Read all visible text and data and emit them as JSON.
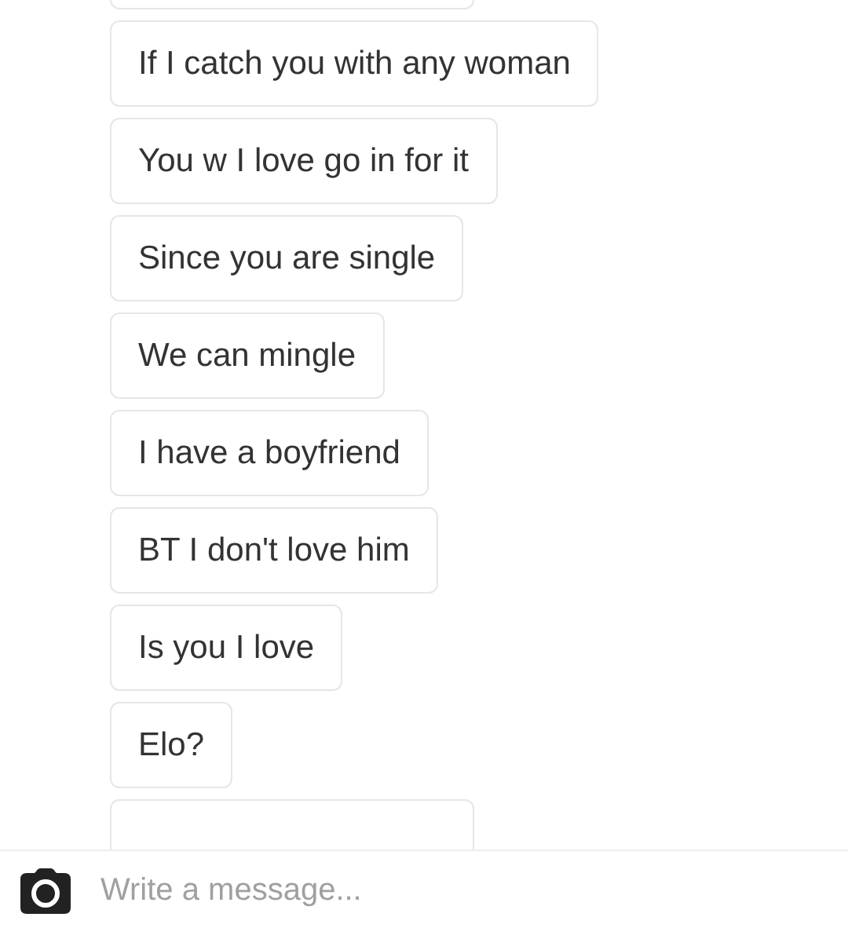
{
  "messages": [
    {
      "kind": "partial"
    },
    {
      "kind": "text",
      "text": "If I catch you with any woman"
    },
    {
      "kind": "text",
      "text": "You w I love go in for it"
    },
    {
      "kind": "text",
      "text": "Since you are single"
    },
    {
      "kind": "text",
      "text": "We can mingle"
    },
    {
      "kind": "text",
      "text": "I have a boyfriend"
    },
    {
      "kind": "text",
      "text": "BT I don't love him"
    },
    {
      "kind": "text",
      "text": "Is you I love"
    },
    {
      "kind": "text",
      "text": "Elo?"
    },
    {
      "kind": "partial"
    }
  ],
  "composer": {
    "placeholder": "Write a message..."
  }
}
